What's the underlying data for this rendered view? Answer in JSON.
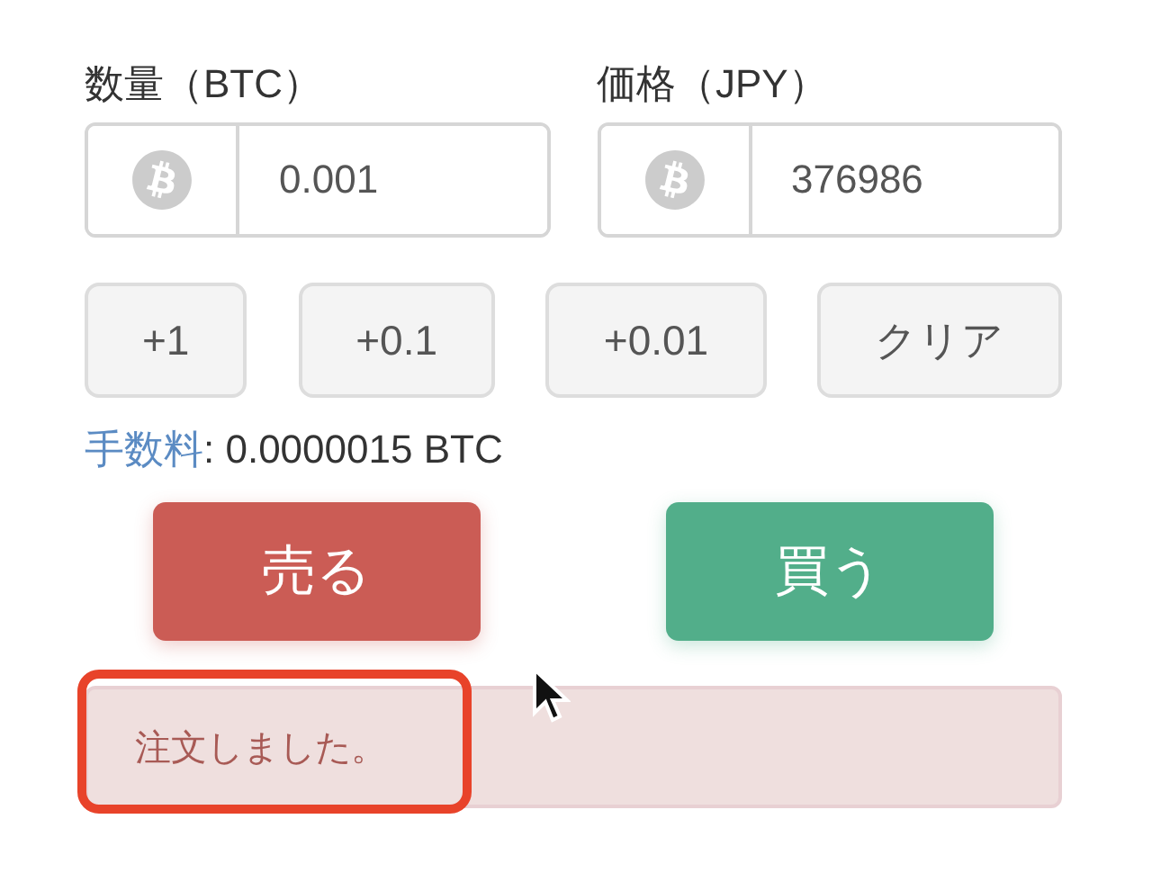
{
  "fields": [
    {
      "label": "数量（BTC）",
      "value": "0.001"
    },
    {
      "label": "価格（JPY）",
      "value": "376986"
    }
  ],
  "quick_buttons": [
    "+1",
    "+0.1",
    "+0.01",
    "クリア"
  ],
  "fee": {
    "label": "手数料",
    "value": ": 0.0000015 BTC"
  },
  "actions": [
    {
      "label": "売る",
      "kind": "sell"
    },
    {
      "label": "買う",
      "kind": "buy"
    }
  ],
  "alert": {
    "message": "注文しました。",
    "highlighted": true
  }
}
